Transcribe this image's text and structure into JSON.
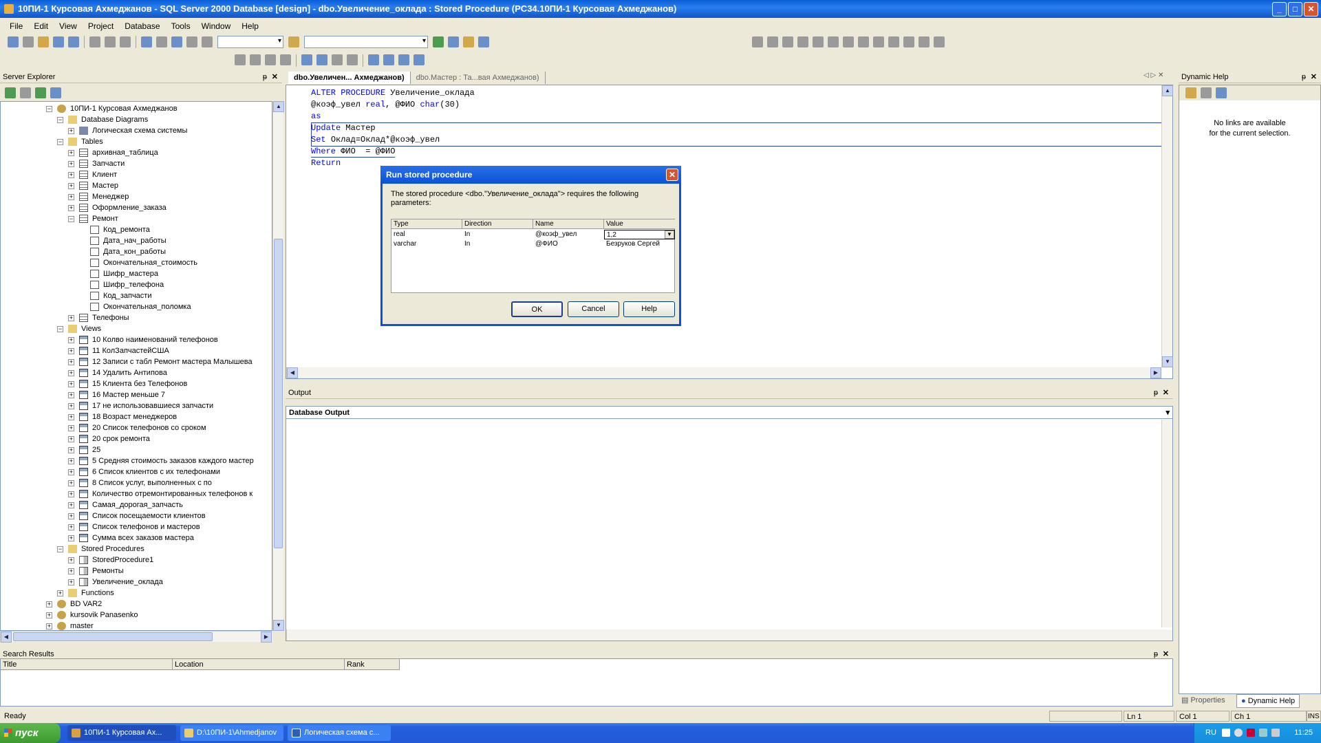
{
  "window": {
    "title": "10ПИ-1 Курсовая Ахмеджанов - SQL Server 2000 Database [design] - dbo.Увеличение_оклада : Stored Procedure (PC34.10ПИ-1 Курсовая Ахмеджанов)",
    "minimize": "_",
    "maximize": "□",
    "close": "✕"
  },
  "menu": [
    "File",
    "Edit",
    "View",
    "Project",
    "Database",
    "Tools",
    "Window",
    "Help"
  ],
  "server_explorer": {
    "title": "Server Explorer",
    "pin": "ᵽ",
    "close": "✕",
    "tree": [
      {
        "level": 4,
        "exp": "−",
        "icon": "db",
        "label": "10ПИ-1 Курсовая Ахмеджанов"
      },
      {
        "level": 5,
        "exp": "−",
        "icon": "folder",
        "label": "Database Diagrams"
      },
      {
        "level": 6,
        "exp": "+",
        "icon": "diag",
        "label": "Логическая схема системы"
      },
      {
        "level": 5,
        "exp": "−",
        "icon": "folder",
        "label": "Tables"
      },
      {
        "level": 6,
        "exp": "+",
        "icon": "table",
        "label": "архивная_таблица"
      },
      {
        "level": 6,
        "exp": "+",
        "icon": "table",
        "label": "Запчасти"
      },
      {
        "level": 6,
        "exp": "+",
        "icon": "table",
        "label": "Клиент"
      },
      {
        "level": 6,
        "exp": "+",
        "icon": "table",
        "label": "Мастер"
      },
      {
        "level": 6,
        "exp": "+",
        "icon": "table",
        "label": "Менеджер"
      },
      {
        "level": 6,
        "exp": "+",
        "icon": "table",
        "label": "Оформление_заказа"
      },
      {
        "level": 6,
        "exp": "−",
        "icon": "table",
        "label": "Ремонт"
      },
      {
        "level": 7,
        "exp": "",
        "icon": "col",
        "label": "Код_ремонта"
      },
      {
        "level": 7,
        "exp": "",
        "icon": "col",
        "label": "Дата_нач_работы"
      },
      {
        "level": 7,
        "exp": "",
        "icon": "col",
        "label": "Дата_кон_работы"
      },
      {
        "level": 7,
        "exp": "",
        "icon": "col",
        "label": "Окончательная_стоимость"
      },
      {
        "level": 7,
        "exp": "",
        "icon": "col",
        "label": "Шифр_мастера"
      },
      {
        "level": 7,
        "exp": "",
        "icon": "col",
        "label": "Шифр_телефона"
      },
      {
        "level": 7,
        "exp": "",
        "icon": "col",
        "label": "Код_запчасти"
      },
      {
        "level": 7,
        "exp": "",
        "icon": "col",
        "label": "Окончательная_поломка"
      },
      {
        "level": 6,
        "exp": "+",
        "icon": "table",
        "label": "Телефоны"
      },
      {
        "level": 5,
        "exp": "−",
        "icon": "folder",
        "label": "Views"
      },
      {
        "level": 6,
        "exp": "+",
        "icon": "view",
        "label": "10 Колво наименований телефонов"
      },
      {
        "level": 6,
        "exp": "+",
        "icon": "view",
        "label": "11 КолЗапчастейСША"
      },
      {
        "level": 6,
        "exp": "+",
        "icon": "view",
        "label": "12 Записи с табл Ремонт мастера Малышева"
      },
      {
        "level": 6,
        "exp": "+",
        "icon": "view",
        "label": "14 Удалить Антипова"
      },
      {
        "level": 6,
        "exp": "+",
        "icon": "view",
        "label": "15 Клиента без Телефонов"
      },
      {
        "level": 6,
        "exp": "+",
        "icon": "view",
        "label": "16 Мастер меньше 7"
      },
      {
        "level": 6,
        "exp": "+",
        "icon": "view",
        "label": "17 не использовавшиеся запчасти"
      },
      {
        "level": 6,
        "exp": "+",
        "icon": "view",
        "label": "18 Возраст менеджеров"
      },
      {
        "level": 6,
        "exp": "+",
        "icon": "view",
        "label": "20 Список телефонов со сроком"
      },
      {
        "level": 6,
        "exp": "+",
        "icon": "view",
        "label": "20 срок ремонта"
      },
      {
        "level": 6,
        "exp": "+",
        "icon": "view",
        "label": "25"
      },
      {
        "level": 6,
        "exp": "+",
        "icon": "view",
        "label": "5 Средняя стоимость заказов каждого мастер"
      },
      {
        "level": 6,
        "exp": "+",
        "icon": "view",
        "label": "6 Список клиентов с их телефонами"
      },
      {
        "level": 6,
        "exp": "+",
        "icon": "view",
        "label": "8 Список услуг, выполненных  с по"
      },
      {
        "level": 6,
        "exp": "+",
        "icon": "view",
        "label": "Количество отремонтированных телефонов к"
      },
      {
        "level": 6,
        "exp": "+",
        "icon": "view",
        "label": "Самая_дорогая_запчасть"
      },
      {
        "level": 6,
        "exp": "+",
        "icon": "view",
        "label": "Список посещаемости клиентов"
      },
      {
        "level": 6,
        "exp": "+",
        "icon": "view",
        "label": "Список телефонов и мастеров"
      },
      {
        "level": 6,
        "exp": "+",
        "icon": "view",
        "label": "Сумма всех заказов мастера"
      },
      {
        "level": 5,
        "exp": "−",
        "icon": "folder",
        "label": "Stored Procedures"
      },
      {
        "level": 6,
        "exp": "+",
        "icon": "sp",
        "label": "StoredProcedure1"
      },
      {
        "level": 6,
        "exp": "+",
        "icon": "sp",
        "label": "Ремонты"
      },
      {
        "level": 6,
        "exp": "+",
        "icon": "sp",
        "label": "Увеличение_оклада"
      },
      {
        "level": 5,
        "exp": "+",
        "icon": "folder",
        "label": "Functions"
      },
      {
        "level": 4,
        "exp": "+",
        "icon": "db",
        "label": "BD VAR2"
      },
      {
        "level": 4,
        "exp": "+",
        "icon": "db",
        "label": "kursovik Panasenko"
      },
      {
        "level": 4,
        "exp": "+",
        "icon": "db",
        "label": "master"
      }
    ]
  },
  "tabs": [
    {
      "label": "dbo.Увеличен... Ахмеджанов)",
      "active": true
    },
    {
      "label": "dbo.Мастер : Та...вая Ахмеджанов)",
      "active": false
    }
  ],
  "editor": {
    "lines": [
      [
        {
          "t": "ALTER PROCEDURE ",
          "k": true
        },
        {
          "t": "Увеличение_оклада",
          "k": false
        }
      ],
      [
        {
          "t": "@коэф_увел ",
          "k": false
        },
        {
          "t": "real",
          "k": true
        },
        {
          "t": ", @ФИО ",
          "k": false
        },
        {
          "t": "char",
          "k": true
        },
        {
          "t": "(30)",
          "k": false
        }
      ],
      [
        {
          "t": "as",
          "k": true
        }
      ],
      [
        {
          "t": "Update ",
          "k": true
        },
        {
          "t": "Мастер",
          "k": false
        }
      ],
      [
        {
          "t": "Set ",
          "k": true
        },
        {
          "t": "Оклад=Оклад*@коэф_увел",
          "k": false
        }
      ],
      [
        {
          "t": "Where ",
          "k": true
        },
        {
          "t": "ФИО  = @ФИО",
          "k": false
        }
      ],
      [
        {
          "t": "Return",
          "k": true
        }
      ]
    ]
  },
  "dialog": {
    "title": "Run stored procedure",
    "close": "✕",
    "message": "The stored procedure <dbo.\"Увеличение_оклада\"> requires the following parameters:",
    "columns": [
      "Type",
      "Direction",
      "Name",
      "Value"
    ],
    "rows": [
      [
        "real",
        "In",
        "@коэф_увел",
        "1,2"
      ],
      [
        "varchar",
        "In",
        "@ФИО",
        "Безруков Сергей"
      ]
    ],
    "ok": "OK",
    "cancel": "Cancel",
    "help": "Help"
  },
  "output": {
    "title": "Output",
    "selector": "Database Output"
  },
  "dynamic_help": {
    "title": "Dynamic Help",
    "message_line1": "No links are available",
    "message_line2": "for the current selection.",
    "tab_properties": "Properties",
    "tab_dynamic": "Dynamic Help"
  },
  "search_results": {
    "title": "Search Results",
    "columns": [
      "Title",
      "Location",
      "Rank"
    ]
  },
  "status": {
    "ready": "Ready",
    "ln": "Ln 1",
    "col": "Col 1",
    "ch": "Ch 1",
    "ins": "INS"
  },
  "taskbar": {
    "start": "пуск",
    "tasks": [
      "10ПИ-1 Курсовая Ах...",
      "D:\\10ПИ-1\\Ahmedjanov",
      "Логическая схема с..."
    ],
    "lang": "RU",
    "time": "11:25"
  }
}
